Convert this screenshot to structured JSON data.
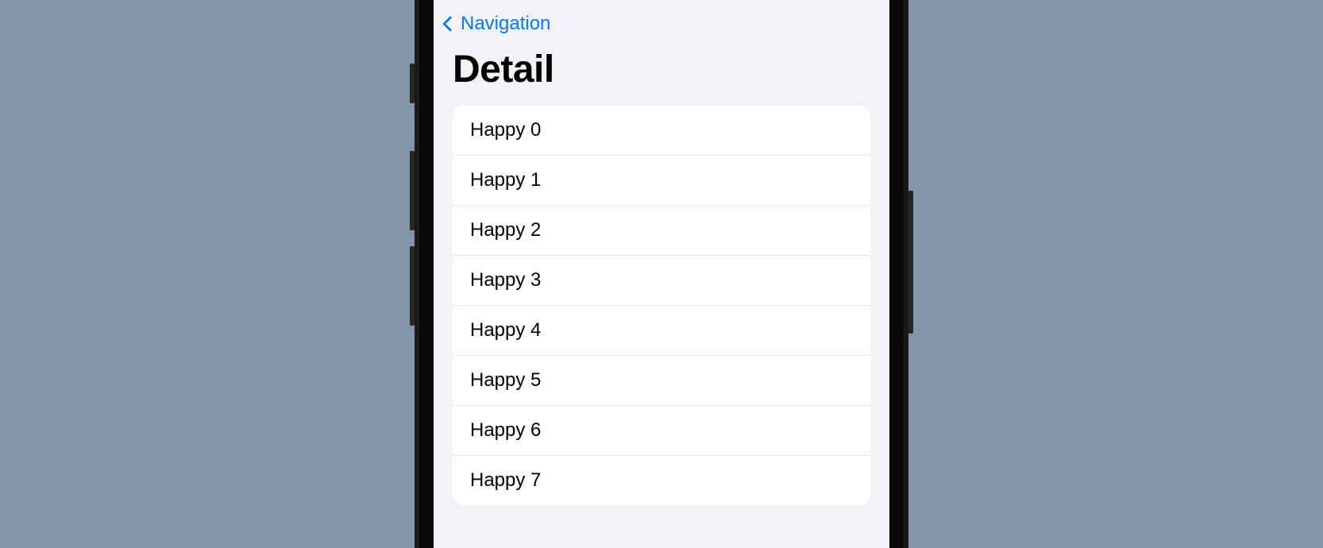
{
  "nav": {
    "back_label": "Navigation"
  },
  "page": {
    "title": "Detail"
  },
  "list": {
    "items": [
      {
        "label": "Happy 0"
      },
      {
        "label": "Happy 1"
      },
      {
        "label": "Happy 2"
      },
      {
        "label": "Happy 3"
      },
      {
        "label": "Happy 4"
      },
      {
        "label": "Happy 5"
      },
      {
        "label": "Happy 6"
      },
      {
        "label": "Happy 7"
      }
    ]
  }
}
